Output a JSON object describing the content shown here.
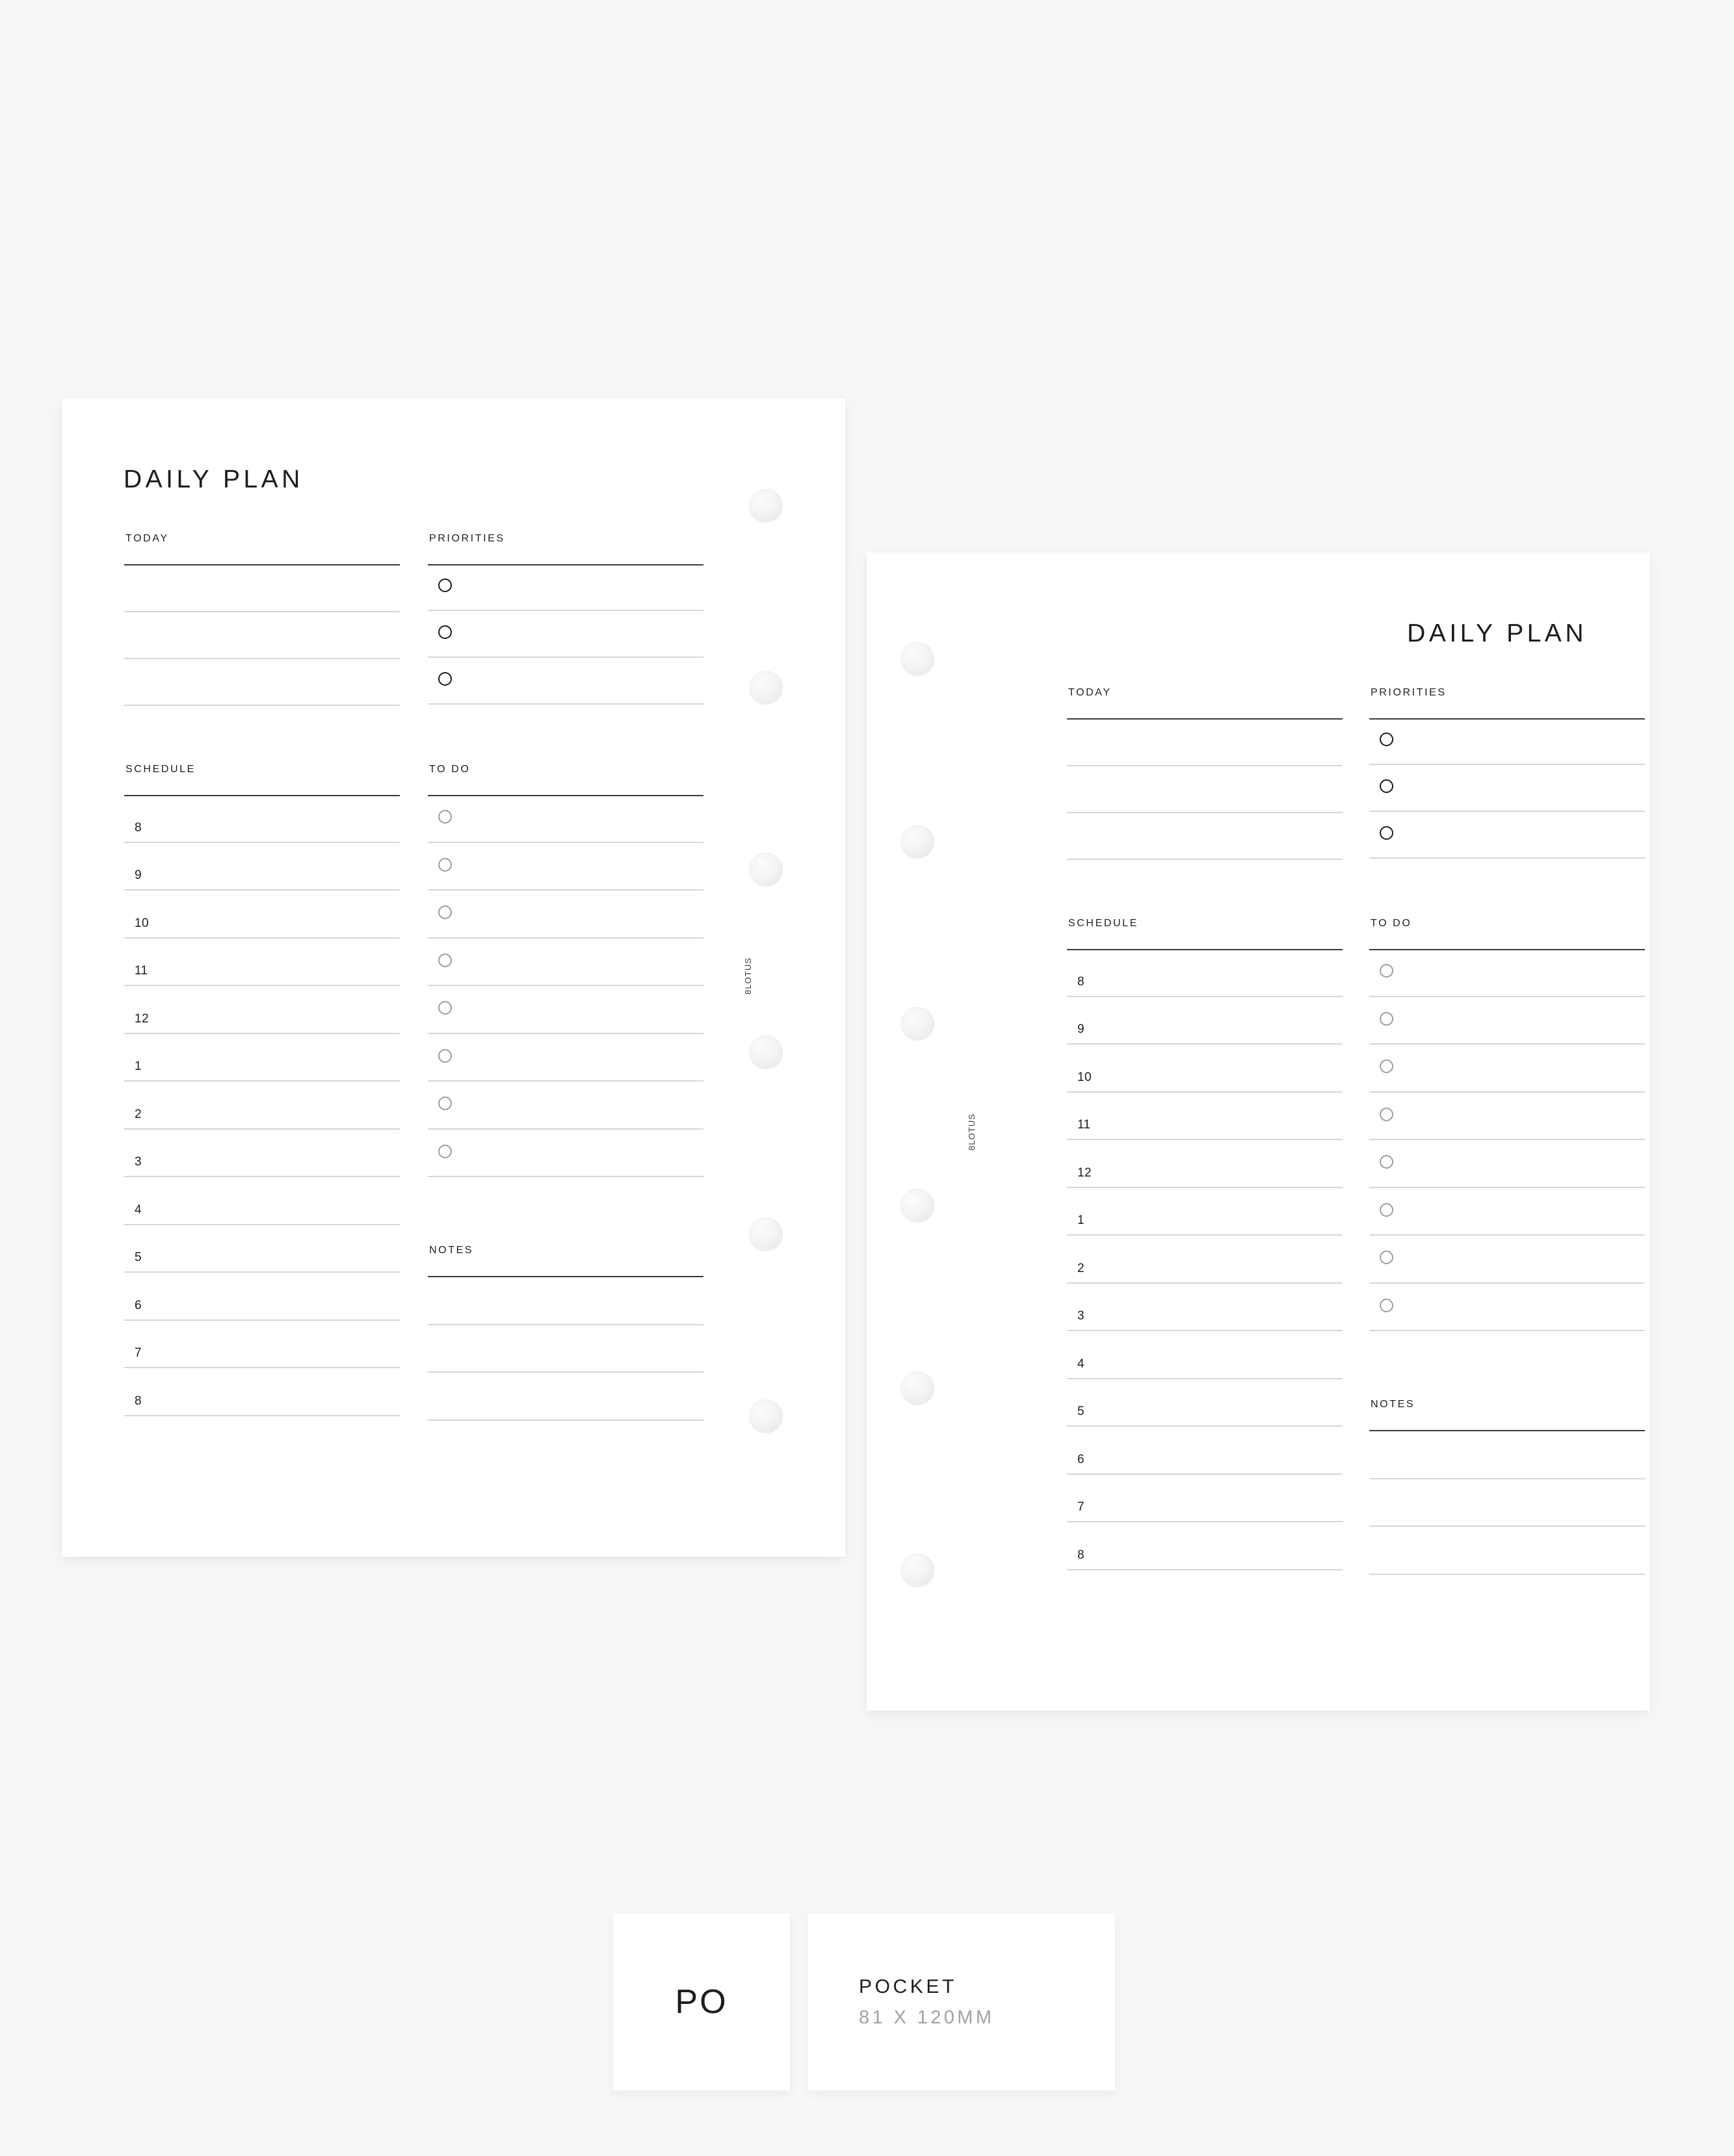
{
  "background_color": "#f7f7f7",
  "brand": "8LOTUS",
  "pages": [
    {
      "id": "left",
      "title": "DAILY PLAN",
      "title_align": "left",
      "sections": {
        "today": {
          "label": "TODAY",
          "line_count": 4
        },
        "priorities": {
          "label": "PRIORITIES",
          "item_count": 3,
          "checkbox_style": "dark"
        },
        "schedule": {
          "label": "SCHEDULE",
          "hours": [
            "8",
            "9",
            "10",
            "11",
            "12",
            "1",
            "2",
            "3",
            "4",
            "5",
            "6",
            "7",
            "8"
          ]
        },
        "todo": {
          "label": "TO DO",
          "item_count": 8,
          "checkbox_style": "light"
        },
        "notes": {
          "label": "NOTES",
          "line_count": 4
        }
      }
    },
    {
      "id": "right",
      "title": "DAILY PLAN",
      "title_align": "right",
      "sections": {
        "today": {
          "label": "TODAY",
          "line_count": 4
        },
        "priorities": {
          "label": "PRIORITIES",
          "item_count": 3,
          "checkbox_style": "dark"
        },
        "schedule": {
          "label": "SCHEDULE",
          "hours": [
            "8",
            "9",
            "10",
            "11",
            "12",
            "1",
            "2",
            "3",
            "4",
            "5",
            "6",
            "7",
            "8"
          ]
        },
        "todo": {
          "label": "TO DO",
          "item_count": 8,
          "checkbox_style": "light"
        },
        "notes": {
          "label": "NOTES",
          "line_count": 4
        }
      }
    }
  ],
  "footer": {
    "size_code": "PO",
    "size_name": "POCKET",
    "size_dimensions": "81 X 120MM"
  },
  "colors": {
    "ink": "#1c1c1c",
    "rule_dark": "#3a3a3a",
    "rule_light": "#d6d6d6",
    "checkbox_light": "#9d9d9d",
    "muted_text": "#a2a2a2",
    "hole": "#efefef"
  }
}
